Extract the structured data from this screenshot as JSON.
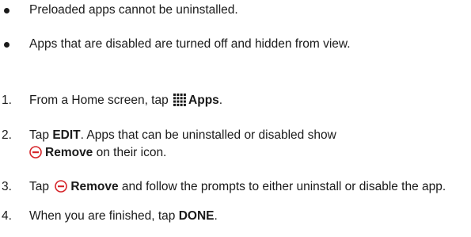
{
  "notes": [
    "Preloaded apps cannot be uninstalled.",
    "Apps that are disabled are turned off and hidden from view."
  ],
  "steps": [
    {
      "number": "1.",
      "text_before": "From a Home screen, tap",
      "icon": "apps-grid-icon",
      "bold": "Apps",
      "text_after": "."
    },
    {
      "number": "2.",
      "text_before": "Tap",
      "bold": "EDIT",
      "text_mid": ". Apps that can be uninstalled or disabled show",
      "icon": "remove-icon",
      "bold2": "Remove",
      "text_after": " on their icon."
    },
    {
      "number": "3.",
      "text_before": "Tap",
      "icon": "remove-icon",
      "bold": "Remove",
      "text_after": " and follow the prompts to either uninstall or disable the app."
    },
    {
      "number": "4.",
      "text_before": "When you are finished, tap",
      "bold": "DONE",
      "text_after": "."
    }
  ],
  "colors": {
    "text": "#1a1a1a",
    "remove_accent": "#d6262b"
  }
}
